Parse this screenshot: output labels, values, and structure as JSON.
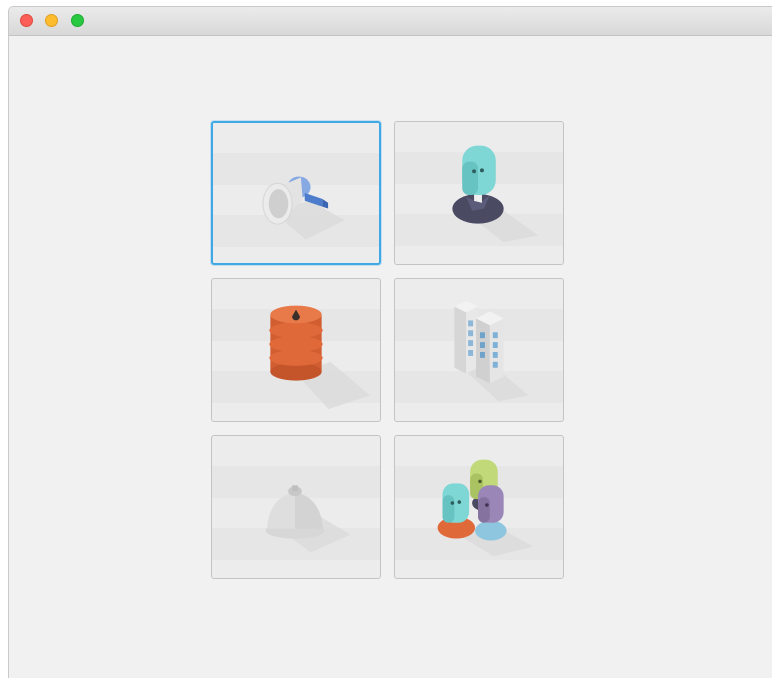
{
  "window": {
    "controls": [
      "close",
      "minimize",
      "zoom"
    ]
  },
  "tiles": [
    {
      "icon": "megaphone-icon",
      "selected": true
    },
    {
      "icon": "person-icon",
      "selected": false
    },
    {
      "icon": "oil-barrel-icon",
      "selected": false
    },
    {
      "icon": "buildings-icon",
      "selected": false
    },
    {
      "icon": "service-bell-icon",
      "selected": false
    },
    {
      "icon": "group-people-icon",
      "selected": false
    }
  ],
  "colors": {
    "selection": "#41a8e6",
    "barrel": "#e0693a",
    "head_teal": "#7fd7d5",
    "head_lime": "#c2d97a",
    "head_purple": "#9a87b8",
    "suit": "#4a4a63"
  }
}
